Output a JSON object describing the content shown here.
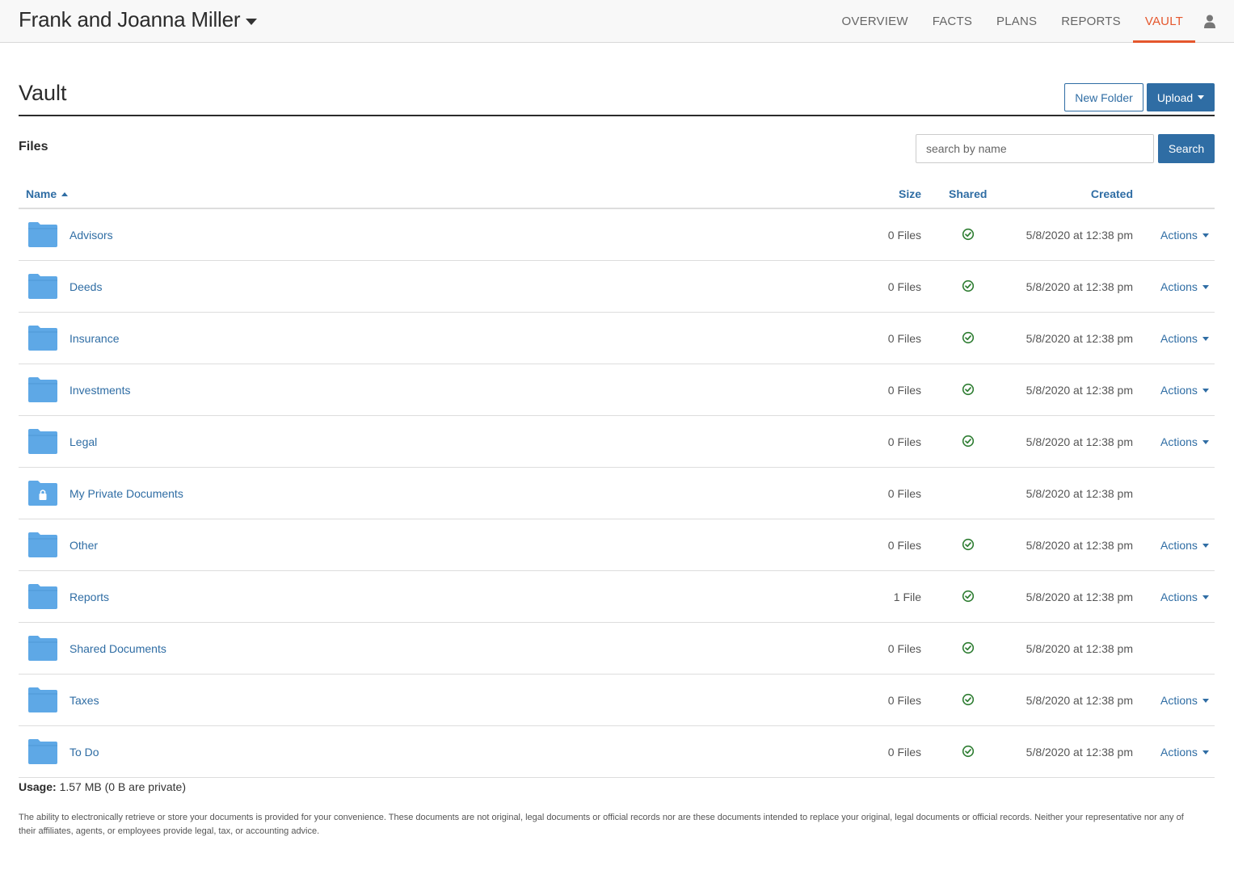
{
  "header": {
    "client_name": "Frank and Joanna Miller",
    "nav": [
      "OVERVIEW",
      "FACTS",
      "PLANS",
      "REPORTS",
      "VAULT"
    ],
    "active_nav": "VAULT"
  },
  "page": {
    "title": "Vault",
    "new_folder_label": "New Folder",
    "upload_label": "Upload",
    "files_label": "Files",
    "search_placeholder": "search by name",
    "search_label": "Search"
  },
  "table": {
    "columns": {
      "name": "Name",
      "size": "Size",
      "shared": "Shared",
      "created": "Created"
    },
    "rows": [
      {
        "name": "Advisors",
        "size": "0 Files",
        "shared": true,
        "created": "5/8/2020 at 12:38 pm",
        "actions": "Actions",
        "private": false
      },
      {
        "name": "Deeds",
        "size": "0 Files",
        "shared": true,
        "created": "5/8/2020 at 12:38 pm",
        "actions": "Actions",
        "private": false
      },
      {
        "name": "Insurance",
        "size": "0 Files",
        "shared": true,
        "created": "5/8/2020 at 12:38 pm",
        "actions": "Actions",
        "private": false
      },
      {
        "name": "Investments",
        "size": "0 Files",
        "shared": true,
        "created": "5/8/2020 at 12:38 pm",
        "actions": "Actions",
        "private": false
      },
      {
        "name": "Legal",
        "size": "0 Files",
        "shared": true,
        "created": "5/8/2020 at 12:38 pm",
        "actions": "Actions",
        "private": false
      },
      {
        "name": "My Private Documents",
        "size": "0 Files",
        "shared": false,
        "created": "5/8/2020 at 12:38 pm",
        "actions": "",
        "private": true
      },
      {
        "name": "Other",
        "size": "0 Files",
        "shared": true,
        "created": "5/8/2020 at 12:38 pm",
        "actions": "Actions",
        "private": false
      },
      {
        "name": "Reports",
        "size": "1 File",
        "shared": true,
        "created": "5/8/2020 at 12:38 pm",
        "actions": "Actions",
        "private": false
      },
      {
        "name": "Shared Documents",
        "size": "0 Files",
        "shared": true,
        "created": "5/8/2020 at 12:38 pm",
        "actions": "",
        "private": false
      },
      {
        "name": "Taxes",
        "size": "0 Files",
        "shared": true,
        "created": "5/8/2020 at 12:38 pm",
        "actions": "Actions",
        "private": false
      },
      {
        "name": "To Do",
        "size": "0 Files",
        "shared": true,
        "created": "5/8/2020 at 12:38 pm",
        "actions": "Actions",
        "private": false
      }
    ]
  },
  "usage": {
    "label": "Usage:",
    "value": "1.57 MB (0 B are private)"
  },
  "disclaimer": "The ability to electronically retrieve or store your documents is provided for your convenience. These documents are not original, legal documents or official records nor are these documents intended to replace your original, legal documents or official records. Neither your representative nor any of their affiliates, agents, or employees provide legal, tax, or accounting advice.",
  "colors": {
    "accent": "#e5572d",
    "primary": "#2f6da4",
    "folder": "#5ea8e6",
    "shared_check": "#2e7d32"
  }
}
